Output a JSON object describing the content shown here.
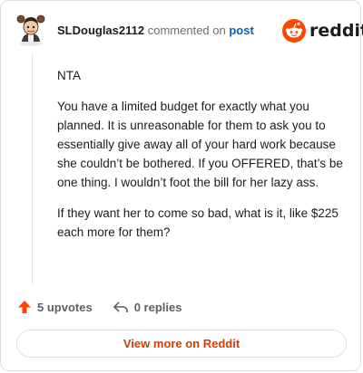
{
  "header": {
    "username": "SLDouglas2112",
    "action_text": "commented on",
    "post_link": "post",
    "brand": "reddit"
  },
  "comment": {
    "paragraphs": [
      "NTA",
      "You have a limited budget for exactly what you planned. It is unreasonable for them to ask you to essentially give away all of your hard work because she couldn’t be bothered. If you OFFERED, that’s be one thing. I wouldn’t foot the bill for her lazy ass.",
      "If they want her to come so bad, what is it, like $225 each more for them?"
    ]
  },
  "actions": {
    "upvotes": "5 upvotes",
    "replies": "0 replies"
  },
  "view_more": {
    "label": "View more on Reddit"
  },
  "colors": {
    "accent": "#d93a00",
    "upvote": "#ff4500",
    "link": "#0a5fb4"
  },
  "icons": [
    "avatar-icon",
    "reddit-logo-icon",
    "upvote-arrow-icon",
    "reply-arrow-icon"
  ]
}
